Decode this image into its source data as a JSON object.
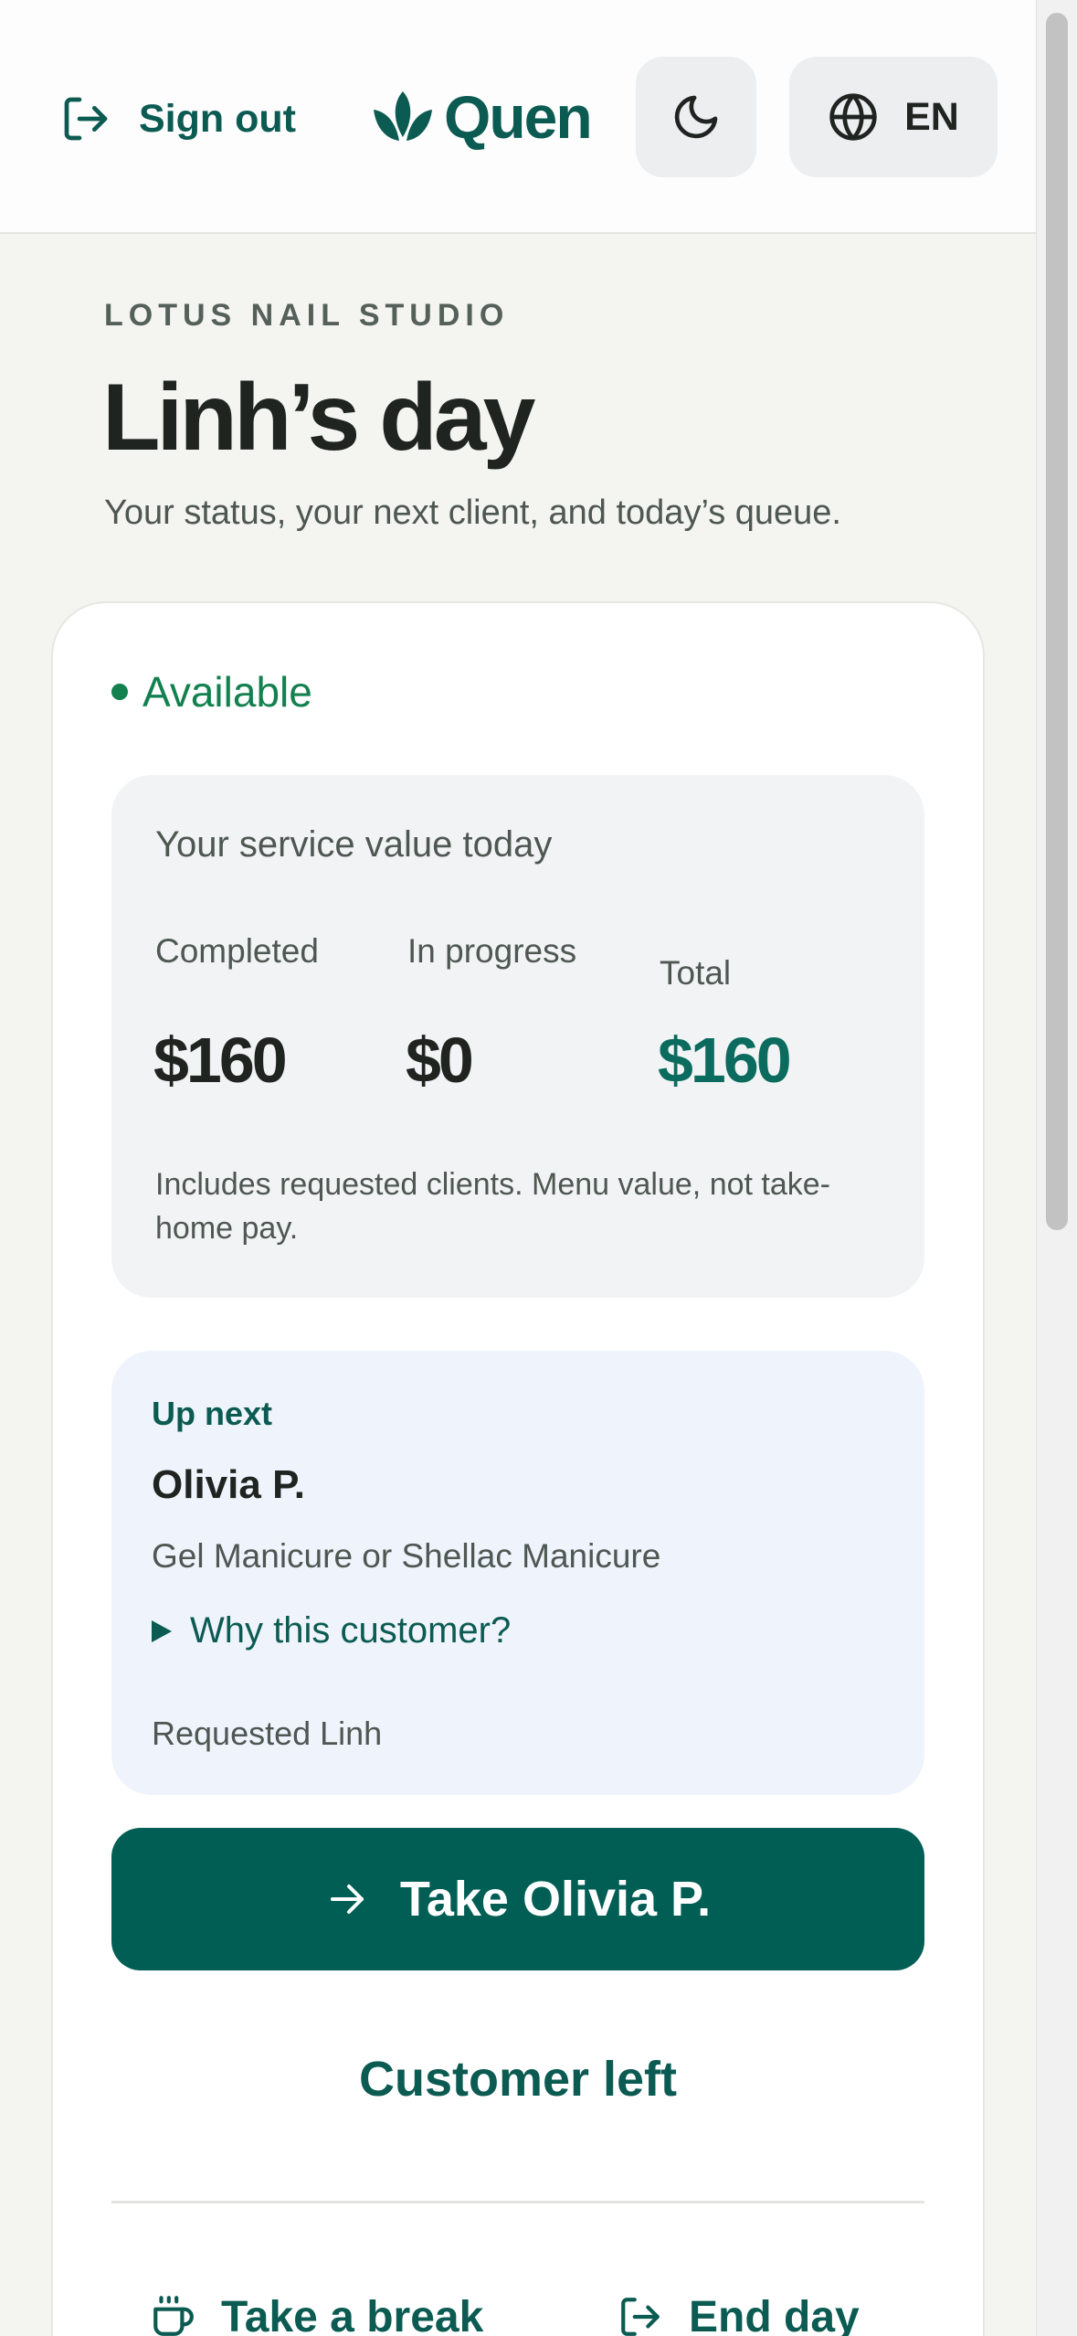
{
  "header": {
    "signout_label": "Sign out",
    "brand_name": "Quen",
    "language_code": "EN",
    "icons": {
      "signout": "sign-out-icon",
      "brand": "leaf-logo-icon",
      "theme": "moon-icon",
      "language": "globe-icon"
    }
  },
  "page": {
    "studio_name": "LOTUS NAIL STUDIO",
    "title": "Linh’s day",
    "subtitle": "Your status, your next client, and today’s queue."
  },
  "status": {
    "label": "Available",
    "color": "#13804f"
  },
  "service_value": {
    "title": "Your service value today",
    "completed": {
      "label": "Completed",
      "value": "$160"
    },
    "in_progress": {
      "label": "In progress",
      "value": "$0"
    },
    "total": {
      "label": "Total",
      "value": "$160"
    },
    "note": "Includes requested clients. Menu value, not take-home pay."
  },
  "up_next": {
    "label": "Up next",
    "customer_name": "Olivia P.",
    "service": "Gel Manicure or Shellac Manicure",
    "why_label": "Why this customer?",
    "requested": "Requested Linh"
  },
  "actions": {
    "take_label": "Take Olivia P.",
    "customer_left_label": "Customer left",
    "break_label": "Take a break",
    "end_day_label": "End day"
  },
  "colors": {
    "accent": "#0b5b52",
    "primary_button": "#005e55",
    "total_value": "#0b6b5e",
    "background": "#f4f4f1",
    "up_next_bg": "#eff3fc"
  }
}
